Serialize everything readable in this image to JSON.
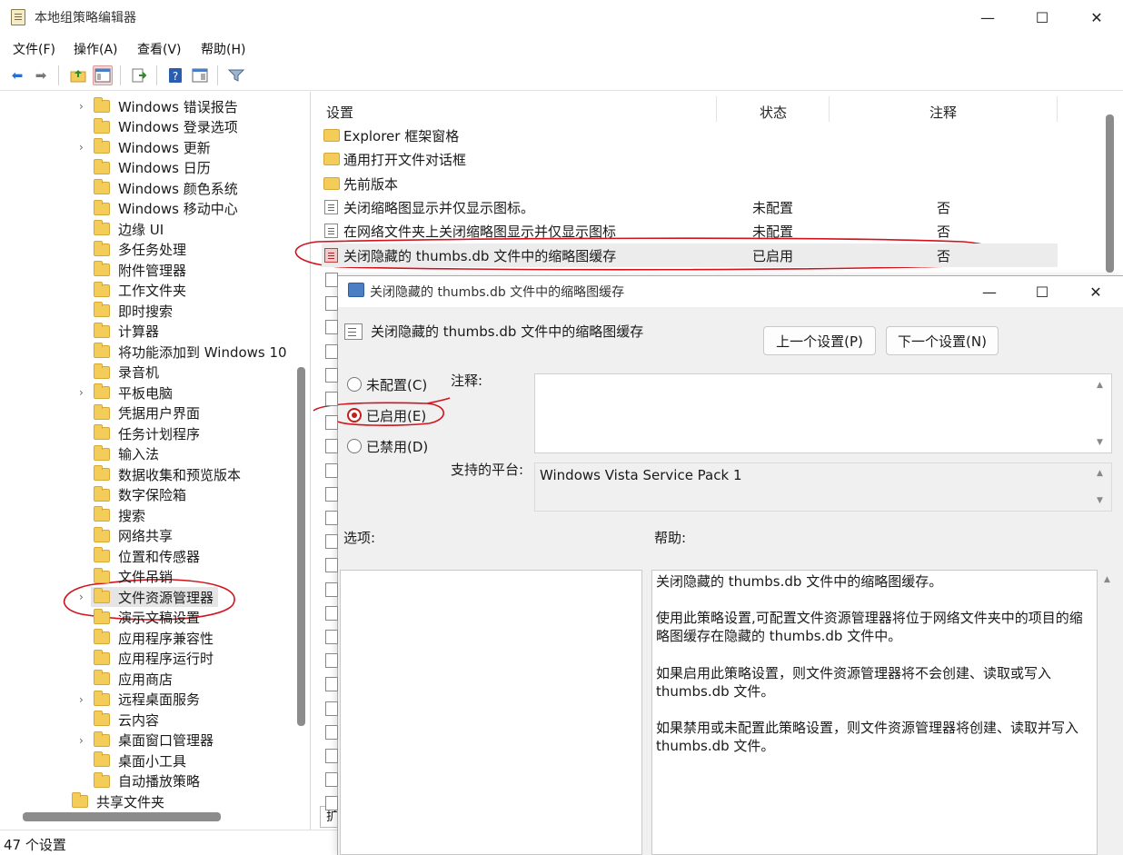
{
  "window": {
    "title": "本地组策略编辑器",
    "minimize": "—",
    "maximize": "☐",
    "close": "✕"
  },
  "menu": [
    "文件(F)",
    "操作(A)",
    "查看(V)",
    "帮助(H)"
  ],
  "toolbar": {
    "icons": [
      "back-arrow-icon",
      "forward-arrow-icon",
      "up-folder-icon",
      "show-hide-tree-icon",
      "export-list-icon",
      "help-icon",
      "properties-icon",
      "filter-icon"
    ]
  },
  "tree": {
    "items": [
      {
        "label": "Windows 错误报告",
        "expandable": true
      },
      {
        "label": "Windows 登录选项",
        "expandable": false
      },
      {
        "label": "Windows 更新",
        "expandable": true
      },
      {
        "label": "Windows 日历",
        "expandable": false
      },
      {
        "label": "Windows 颜色系统",
        "expandable": false
      },
      {
        "label": "Windows 移动中心",
        "expandable": false
      },
      {
        "label": "边缘 UI",
        "expandable": false
      },
      {
        "label": "多任务处理",
        "expandable": false
      },
      {
        "label": "附件管理器",
        "expandable": false
      },
      {
        "label": "工作文件夹",
        "expandable": false
      },
      {
        "label": "即时搜索",
        "expandable": false
      },
      {
        "label": "计算器",
        "expandable": false
      },
      {
        "label": "将功能添加到 Windows 10",
        "expandable": false
      },
      {
        "label": "录音机",
        "expandable": false
      },
      {
        "label": "平板电脑",
        "expandable": true
      },
      {
        "label": "凭据用户界面",
        "expandable": false
      },
      {
        "label": "任务计划程序",
        "expandable": false
      },
      {
        "label": "输入法",
        "expandable": false
      },
      {
        "label": "数据收集和预览版本",
        "expandable": false
      },
      {
        "label": "数字保险箱",
        "expandable": false
      },
      {
        "label": "搜索",
        "expandable": false
      },
      {
        "label": "网络共享",
        "expandable": false
      },
      {
        "label": "位置和传感器",
        "expandable": false
      },
      {
        "label": "文件吊销",
        "expandable": false
      },
      {
        "label": "文件资源管理器",
        "expandable": true,
        "selected": true
      },
      {
        "label": "演示文稿设置",
        "expandable": false
      },
      {
        "label": "应用程序兼容性",
        "expandable": false
      },
      {
        "label": "应用程序运行时",
        "expandable": false
      },
      {
        "label": "应用商店",
        "expandable": false
      },
      {
        "label": "远程桌面服务",
        "expandable": true
      },
      {
        "label": "云内容",
        "expandable": false
      },
      {
        "label": "桌面窗口管理器",
        "expandable": true
      },
      {
        "label": "桌面小工具",
        "expandable": false
      },
      {
        "label": "自动播放策略",
        "expandable": false
      }
    ],
    "parent_item": "共享文件夹"
  },
  "list": {
    "columns": [
      "设置",
      "状态",
      "注释"
    ],
    "rows": [
      {
        "type": "folder",
        "name": "Explorer 框架窗格",
        "state": "",
        "note": ""
      },
      {
        "type": "folder",
        "name": "通用打开文件对话框",
        "state": "",
        "note": ""
      },
      {
        "type": "folder",
        "name": "先前版本",
        "state": "",
        "note": ""
      },
      {
        "type": "setting",
        "name": "关闭缩略图显示并仅显示图标。",
        "state": "未配置",
        "note": "否"
      },
      {
        "type": "setting",
        "name": "在网络文件夹上关闭缩略图显示并仅显示图标",
        "state": "未配置",
        "note": "否"
      },
      {
        "type": "setting-enabled",
        "name": "关闭隐藏的 thumbs.db 文件中的缩略图缓存",
        "state": "已启用",
        "note": "否",
        "selected": true
      }
    ],
    "tab_stub": "扩"
  },
  "status": {
    "text": "47 个设置"
  },
  "dialog": {
    "title": "关闭隐藏的 thumbs.db 文件中的缩略图缓存",
    "heading": "关闭隐藏的 thumbs.db 文件中的缩略图缓存",
    "prev_button": "上一个设置(P)",
    "next_button": "下一个设置(N)",
    "radios": [
      {
        "label": "未配置(C)",
        "checked": false
      },
      {
        "label": "已启用(E)",
        "checked": true
      },
      {
        "label": "已禁用(D)",
        "checked": false
      }
    ],
    "comment_label": "注释:",
    "comment_value": "",
    "platform_label": "支持的平台:",
    "platform_value": "Windows Vista Service Pack 1",
    "options_label": "选项:",
    "help_label": "帮助:",
    "help_paragraphs": [
      "关闭隐藏的 thumbs.db 文件中的缩略图缓存。",
      "使用此策略设置,可配置文件资源管理器将位于网络文件夹中的项目的缩略图缓存在隐藏的 thumbs.db 文件中。",
      "如果启用此策略设置，则文件资源管理器将不会创建、读取或写入 thumbs.db 文件。",
      "如果禁用或未配置此策略设置，则文件资源管理器将创建、读取并写入 thumbs.db 文件。"
    ]
  },
  "colors": {
    "annotation_red": "#d0141e",
    "selection_gray": "#e5e5e5",
    "folder_yellow": "#f4cc5a"
  }
}
